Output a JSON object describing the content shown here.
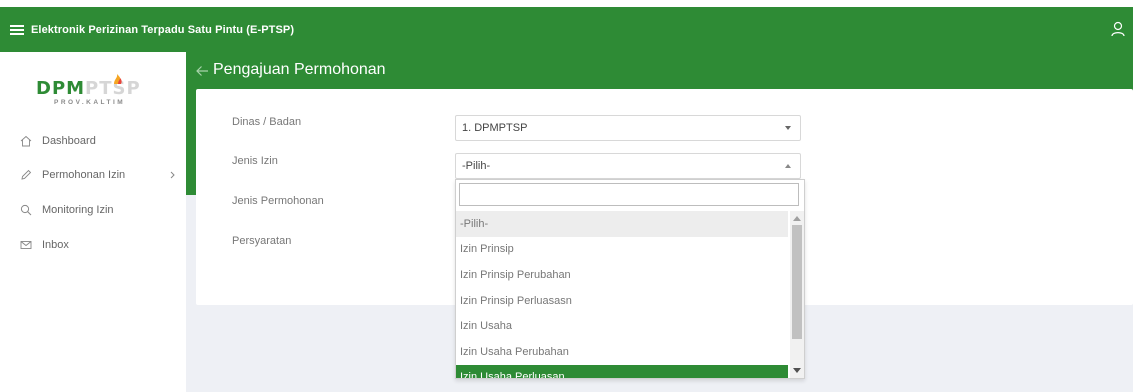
{
  "header": {
    "title": "Elektronik Perizinan Terpadu Satu Pintu (E-PTSP)"
  },
  "logo": {
    "main": "DPM",
    "accent": "PTSP",
    "sub": "PROV.KALTIM"
  },
  "sidebar": {
    "items": [
      {
        "label": "Dashboard",
        "icon": "home-icon"
      },
      {
        "label": "Permohonan Izin",
        "icon": "pencil-icon"
      },
      {
        "label": "Monitoring Izin",
        "icon": "search-icon"
      },
      {
        "label": "Inbox",
        "icon": "mail-icon"
      }
    ]
  },
  "page": {
    "title": "Pengajuan Permohonan"
  },
  "form": {
    "dinas_label": "Dinas / Badan",
    "dinas_value": "1. DPMPTSP",
    "jenis_izin_label": "Jenis Izin",
    "jenis_izin_value": "-Pilih-",
    "jenis_permohonan_label": "Jenis Permohonan",
    "persyaratan_label": "Persyaratan"
  },
  "dropdown": {
    "search_value": "",
    "options": [
      "-Pilih-",
      "Izin Prinsip",
      "Izin Prinsip Perubahan",
      "Izin Prinsip Perluasasn",
      "Izin Usaha",
      "Izin Usaha Perubahan",
      "Izin Usaha Perluasan"
    ],
    "hovered_index": 0,
    "selected_index": 6
  },
  "colors": {
    "brand": "#2e8b35",
    "content_bg": "#eef0f5"
  }
}
